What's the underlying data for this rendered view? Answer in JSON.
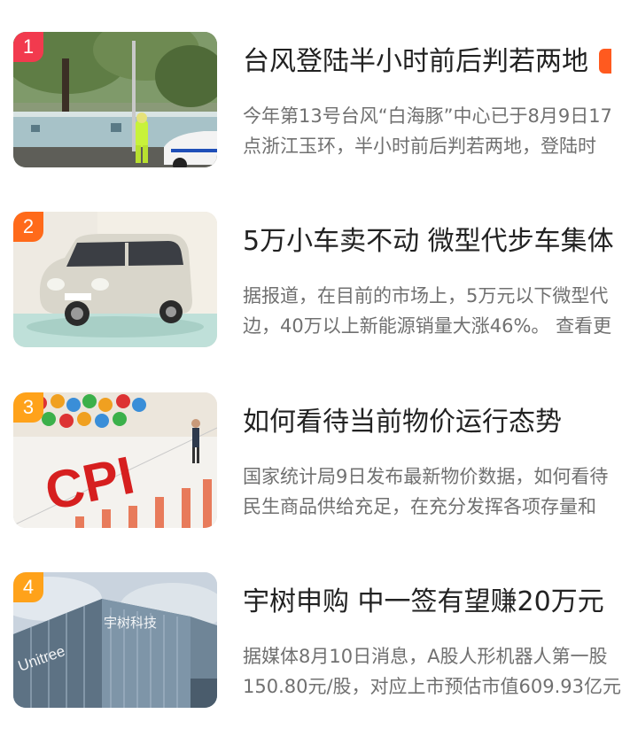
{
  "colors": {
    "rank_1": "#f23a4e",
    "rank_2": "#ff6a1a",
    "rank_3": "#ffa21a",
    "rank_4": "#ffa21a",
    "hot_tag": "#ff5a1f"
  },
  "news": [
    {
      "rank": "1",
      "title": "台风登陆半小时前后判若两地",
      "summary_line1": "今年第13号台风“白海豚”中心已于8月9日17",
      "summary_line2": "点浙江玉环，半小时前后判若两地，登陆时"
    },
    {
      "rank": "2",
      "title": "5万小车卖不动 微型代步车集体",
      "summary_line1": "据报道，在目前的市场上，5万元以下微型代",
      "summary_line2": "边，40万以上新能源销量大涨46%。 查看更"
    },
    {
      "rank": "3",
      "title": "如何看待当前物价运行态势",
      "summary_line1": "国家统计局9日发布最新物价数据，如何看待",
      "summary_line2": "民生商品供给充足，在充分发挥各项存量和"
    },
    {
      "rank": "4",
      "title": "宇树申购 中一签有望赚20万元",
      "summary_line1": "据媒体8月10日消息，A股人形机器人第一股",
      "summary_line2": "150.80元/股，对应上市预估市值609.93亿元"
    }
  ],
  "images": {
    "cpi_text": "CPI",
    "unitree_text": "Unitree",
    "unitree_cn": "宇树科技"
  }
}
